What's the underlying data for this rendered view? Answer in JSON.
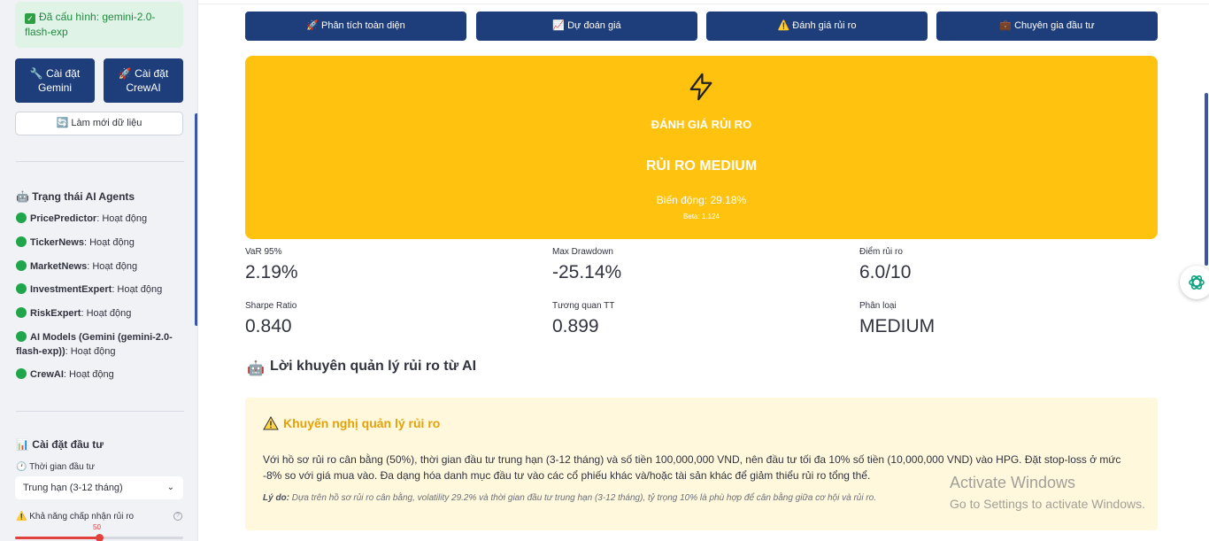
{
  "sidebar": {
    "config_text": "Đã cấu hình: gemini-2.0-flash-exp",
    "btn_gemini": "Cài đặt Gemini",
    "btn_crewai": "Cài đặt CrewAI",
    "refresh_label": "🔄 Làm mới dữ liệu",
    "agents_title": "Trạng thái AI Agents",
    "agents": [
      {
        "name": "PricePredictor",
        "status": ": Hoạt động"
      },
      {
        "name": "TickerNews",
        "status": ": Hoạt động"
      },
      {
        "name": "MarketNews",
        "status": ": Hoạt động"
      },
      {
        "name": "InvestmentExpert",
        "status": ": Hoạt động"
      },
      {
        "name": "RiskExpert",
        "status": ": Hoạt động"
      },
      {
        "name": "AI Models (Gemini (gemini-2.0-flash-exp))",
        "status": ": Hoạt động"
      },
      {
        "name": "CrewAI",
        "status": ": Hoạt động"
      }
    ],
    "settings_title": "Cài đặt đầu tư",
    "time_label": "Thời gian đầu tư",
    "time_value": "Trung hạn (3-12 tháng)",
    "risk_label": "Khả năng chấp nhận rủi ro",
    "risk_value": "50",
    "risk_fraction": 0.5
  },
  "tabs": [
    {
      "label": "Phân tích toàn diện",
      "icon": "rocket-icon"
    },
    {
      "label": "Dự đoán giá",
      "icon": "chart-icon"
    },
    {
      "label": "Đánh giá rủi ro",
      "icon": "warning-icon"
    },
    {
      "label": "Chuyên gia đầu tư",
      "icon": "briefcase-icon"
    }
  ],
  "risk_card": {
    "title": "ĐÁNH GIÁ RỦI RO",
    "level": "RỦI RO MEDIUM",
    "volatility": "Biến động: 29.18%",
    "beta": "Beta: 1.124",
    "color": "#ffc20e"
  },
  "metrics": [
    {
      "label": "VaR 95%",
      "value": "2.19%"
    },
    {
      "label": "Max Drawdown",
      "value": "-25.14%"
    },
    {
      "label": "Điểm rủi ro",
      "value": "6.0/10"
    },
    {
      "label": "Sharpe Ratio",
      "value": "0.840"
    },
    {
      "label": "Tương quan TT",
      "value": "0.899"
    },
    {
      "label": "Phân loại",
      "value": "MEDIUM"
    }
  ],
  "advice": {
    "section_title": "Lời khuyên quản lý rủi ro từ AI",
    "heading": "Khuyến nghị quản lý rủi ro",
    "body": "Với hồ sơ rủi ro cân bằng (50%), thời gian đầu tư trung hạn (3-12 tháng) và số tiền 100,000,000 VND, nên đầu tư tối đa 10% số tiền (10,000,000 VND) vào HPG. Đặt stop-loss ở mức -8% so với giá mua vào. Đa dạng hóa danh mục đầu tư vào các cổ phiếu khác và/hoặc tài sản khác để giảm thiểu rủi ro tổng thể.",
    "reason_label": "Lý do:",
    "reason_text": " Dựa trên hồ sơ rủi ro cân bằng, volatility 29.2% và thời gian đầu tư trung hạn (3-12 tháng), tỷ trọng 10% là phù hợp để cân bằng giữa cơ hội và rủi ro."
  },
  "watermark": {
    "line1": "Activate Windows",
    "line2": "Go to Settings to activate Windows."
  }
}
